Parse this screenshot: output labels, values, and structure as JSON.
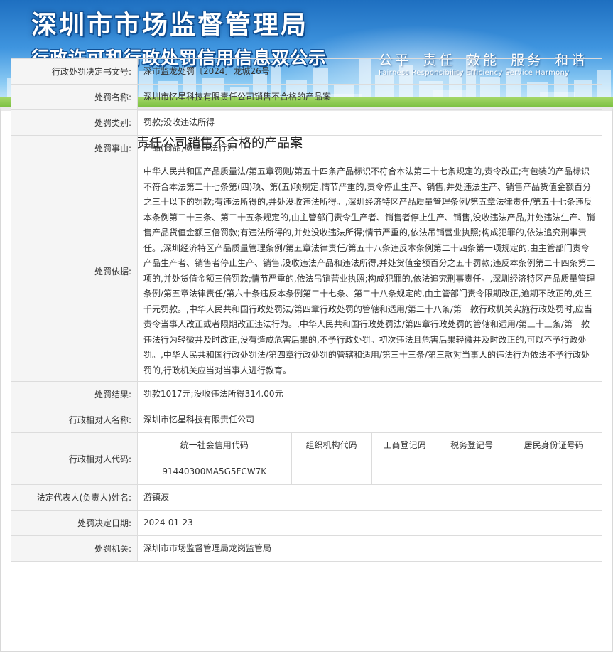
{
  "banner": {
    "title": "深圳市市场监督管理局",
    "subtitle": "行政许可和行政处罚信用信息双公示",
    "slogan": "公平 责任 效能 服务 和谐",
    "slogan_en": "Fairness Responsibility Efficiency Service Harmony"
  },
  "case": {
    "title": "深圳市忆星科技有限责任公司销售不合格的产品案"
  },
  "fields": {
    "decision_no": {
      "label": "行政处罚决定书文号:",
      "value": "深市监龙处罚〔2024〕龙城26号"
    },
    "penalty_name": {
      "label": "处罚名称:",
      "value": "深圳市忆星科技有限责任公司销售不合格的产品案"
    },
    "penalty_type": {
      "label": "处罚类别:",
      "value": "罚款;没收违法所得"
    },
    "penalty_cause": {
      "label": "处罚事由:",
      "value": "产品(商品)质量违法行为"
    },
    "penalty_basis": {
      "label": "处罚依据:",
      "value": "中华人民共和国产品质量法/第五章罚则/第五十四条产品标识不符合本法第二十七条规定的,责令改正;有包装的产品标识不符合本法第二十七条第(四)项、第(五)项规定,情节严重的,责令停止生产、销售,并处违法生产、销售产品货值金额百分之三十以下的罚款;有违法所得的,并处没收违法所得。,深圳经济特区产品质量管理条例/第五章法律责任/第五十七条违反本条例第二十三条、第二十五条规定的,由主管部门责令生产者、销售者停止生产、销售,没收违法产品,并处违法生产、销售产品货值金额三倍罚款;有违法所得的,并处没收违法所得;情节严重的,依法吊销营业执照;构成犯罪的,依法追究刑事责任。,深圳经济特区产品质量管理条例/第五章法律责任/第五十八条违反本条例第二十四条第一项规定的,由主管部门责令产品生产者、销售者停止生产、销售,没收违法产品和违法所得,并处货值金额百分之五十罚款;违反本条例第二十四条第二项的,并处货值金额三倍罚款;情节严重的,依法吊销营业执照;构成犯罪的,依法追究刑事责任。,深圳经济特区产品质量管理条例/第五章法律责任/第六十条违反本条例第二十七条、第二十八条规定的,由主管部门责令限期改正,逾期不改正的,处三千元罚款。,中华人民共和国行政处罚法/第四章行政处罚的管辖和适用/第二十八条/第一款行政机关实施行政处罚时,应当责令当事人改正或者限期改正违法行为。,中华人民共和国行政处罚法/第四章行政处罚的管辖和适用/第三十三条/第一款违法行为轻微并及时改正,没有造成危害后果的,不予行政处罚。初次违法且危害后果轻微并及时改正的,可以不予行政处罚。,中华人民共和国行政处罚法/第四章行政处罚的管辖和适用/第三十三条/第三款对当事人的违法行为依法不予行政处罚的,行政机关应当对当事人进行教育。"
    },
    "penalty_result": {
      "label": "处罚结果:",
      "value": "罚款1017元;没收违法所得314.00元"
    },
    "party_name": {
      "label": "行政相对人名称:",
      "value": "深圳市忆星科技有限责任公司"
    },
    "party_code": {
      "label": "行政相对人代码:",
      "headers": [
        "统一社会信用代码",
        "组织机构代码",
        "工商登记码",
        "税务登记号",
        "居民身份证号码"
      ],
      "values": [
        "91440300MA5G5FCW7K",
        "",
        "",
        "",
        ""
      ]
    },
    "legal_rep": {
      "label": "法定代表人(负责人)姓名:",
      "value": "游镇波"
    },
    "decision_date": {
      "label": "处罚决定日期:",
      "value": "2024-01-23"
    },
    "authority": {
      "label": "处罚机关:",
      "value": "深圳市市场监督管理局龙岗监管局"
    }
  },
  "colors": {
    "title_mark": "#8c1515",
    "label_bg": "#f5f5f5",
    "border": "#dcdcdc"
  }
}
